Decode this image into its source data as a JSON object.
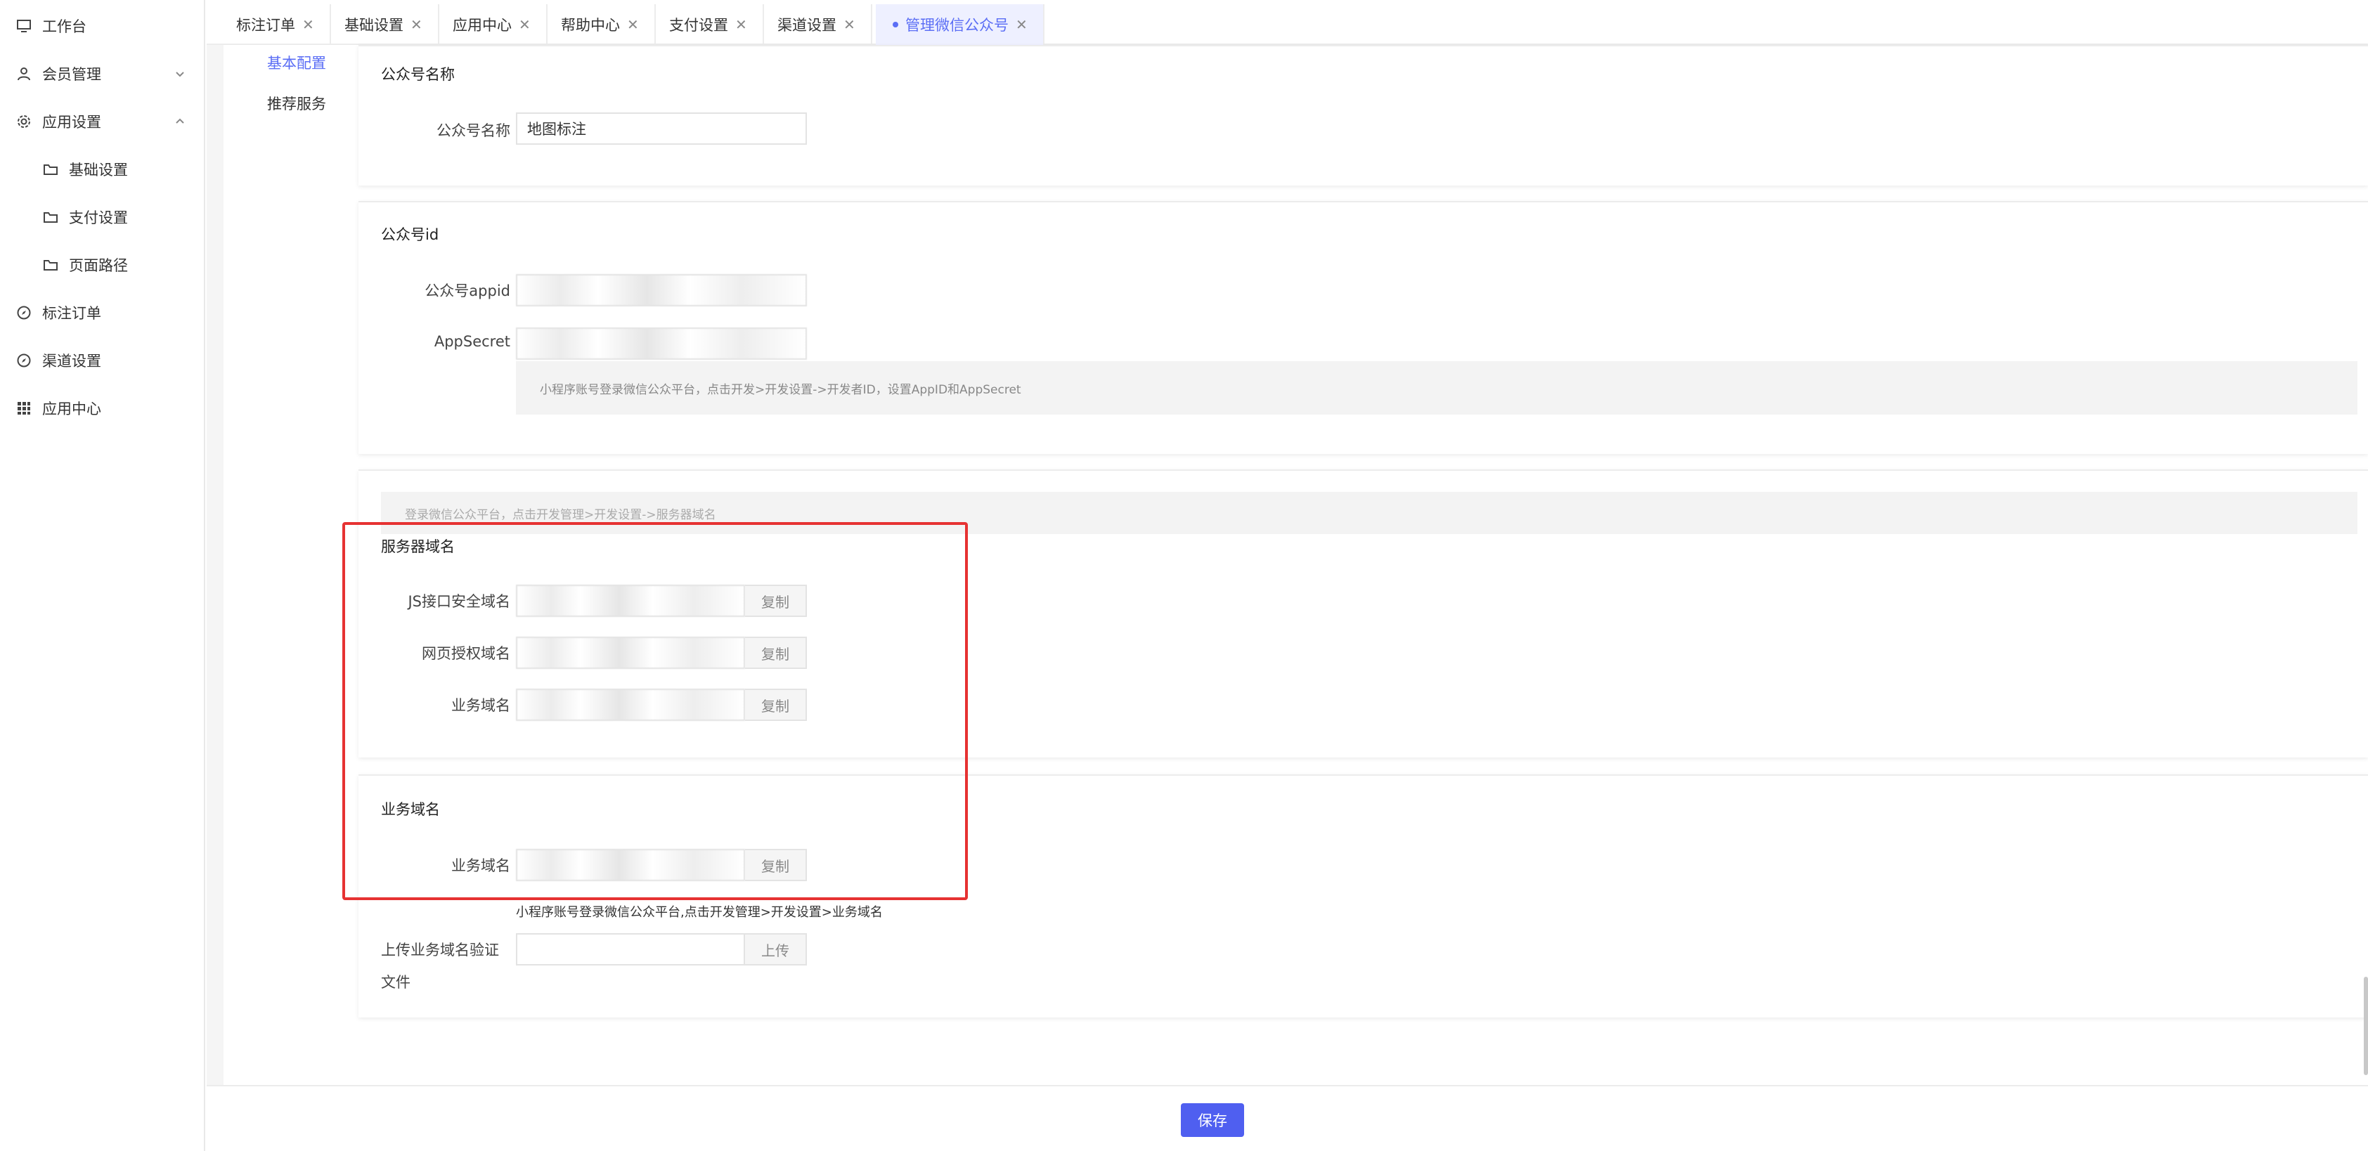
{
  "sidebar": {
    "items": [
      {
        "label": "工作台",
        "icon": "monitor-icon"
      },
      {
        "label": "会员管理",
        "icon": "user-icon",
        "chevron": "chevron-down-icon"
      },
      {
        "label": "应用设置",
        "icon": "gear-icon",
        "chevron": "chevron-up-icon"
      },
      {
        "label": "基础设置",
        "icon": "folder-icon"
      },
      {
        "label": "支付设置",
        "icon": "folder-icon"
      },
      {
        "label": "页面路径",
        "icon": "folder-icon"
      },
      {
        "label": "标注订单",
        "icon": "compass-icon"
      },
      {
        "label": "渠道设置",
        "icon": "compass-icon"
      },
      {
        "label": "应用中心",
        "icon": "grid-icon"
      }
    ]
  },
  "tabs": [
    {
      "label": "标注订单"
    },
    {
      "label": "基础设置"
    },
    {
      "label": "应用中心"
    },
    {
      "label": "帮助中心"
    },
    {
      "label": "支付设置"
    },
    {
      "label": "渠道设置"
    },
    {
      "label": "管理微信公众号",
      "active": true
    }
  ],
  "subnav": {
    "items": [
      "基本配置",
      "推荐服务"
    ]
  },
  "section_name": {
    "title": "公众号名称",
    "label": "公众号名称",
    "value": "地图标注"
  },
  "section_id": {
    "title": "公众号id",
    "appid_label": "公众号appid",
    "secret_label": "AppSecret",
    "hint": "小程序账号登录微信公众平台，点击开发>开发设置->开发者ID，设置AppID和AppSecret"
  },
  "section_server": {
    "hint": "登录微信公众平台，点击开发管理>开发设置->服务器域名",
    "title": "服务器域名",
    "js_label": "JS接口安全域名",
    "oauth_label": "网页授权域名",
    "biz_label": "业务域名",
    "copy_label": "复制"
  },
  "section_biz": {
    "title": "业务域名",
    "label": "业务域名",
    "copy_label": "复制",
    "hint": "小程序账号登录微信公众平台,点击开发管理>开发设置>业务域名",
    "upload_label_line1": "上传业务域名验证",
    "upload_label_line2": "文件",
    "upload_btn": "上传"
  },
  "footer": {
    "save_label": "保存"
  },
  "colors": {
    "accent": "#5b6ef5",
    "primary_button": "#4f5ff0",
    "highlight_border": "#e63232"
  }
}
